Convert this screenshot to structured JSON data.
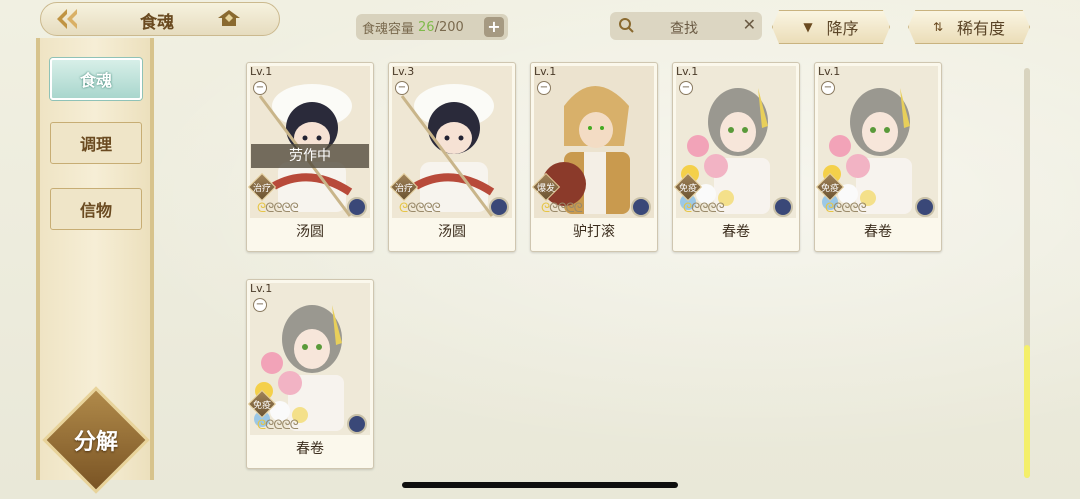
{
  "header": {
    "title": "食魂",
    "capacity_label": "食魂容量",
    "capacity_current": "26",
    "capacity_total": "/200",
    "add_symbol": "+",
    "search_label": "查找",
    "clear_symbol": "✕",
    "sort_order_label": "降序",
    "sort_rarity_label": "稀有度"
  },
  "sidebar": {
    "tabs": [
      {
        "label": "食魂",
        "active": true
      },
      {
        "label": "调理",
        "active": false
      },
      {
        "label": "信物",
        "active": false
      }
    ],
    "decompose_label": "分解"
  },
  "cards": [
    {
      "level": "Lv.1",
      "name": "汤圆",
      "role": "治疗",
      "status": "劳作中",
      "stars_gold": 1,
      "stars_total": 5,
      "element_color": "#3a4878",
      "portrait": "boy-dark-hair-white-hat"
    },
    {
      "level": "Lv.3",
      "name": "汤圆",
      "role": "治疗",
      "status": "",
      "stars_gold": 1,
      "stars_total": 5,
      "element_color": "#3a4878",
      "portrait": "boy-dark-hair-white-hat"
    },
    {
      "level": "Lv.1",
      "name": "驴打滚",
      "role": "爆发",
      "status": "",
      "stars_gold": 1,
      "stars_total": 5,
      "element_color": "#3a4878",
      "portrait": "blonde-warrior"
    },
    {
      "level": "Lv.1",
      "name": "春卷",
      "role": "免疫",
      "status": "",
      "stars_gold": 1,
      "stars_total": 5,
      "element_color": "#3a4878",
      "portrait": "girl-gray-hair-flowers"
    },
    {
      "level": "Lv.1",
      "name": "春卷",
      "role": "免疫",
      "status": "",
      "stars_gold": 1,
      "stars_total": 5,
      "element_color": "#3a4878",
      "portrait": "girl-gray-hair-flowers"
    },
    {
      "level": "Lv.1",
      "name": "春卷",
      "role": "免疫",
      "status": "",
      "stars_gold": 1,
      "stars_total": 5,
      "element_color": "#3a4878",
      "portrait": "girl-gray-hair-flowers"
    }
  ],
  "colors": {
    "accent_gold": "#c09443",
    "capacity_green": "#7fba4a",
    "active_tab": "#a9d6cd",
    "scroll_thumb": "#f4ef6a"
  }
}
